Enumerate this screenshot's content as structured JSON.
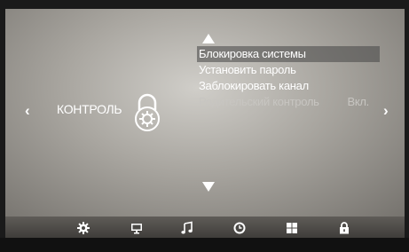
{
  "section": {
    "title": "КОНТРОЛЬ",
    "icon": "lock-gear-icon"
  },
  "nav": {
    "left_icon": "chevron-left-icon",
    "right_icon": "chevron-right-icon",
    "left_glyph": "‹",
    "right_glyph": "›"
  },
  "menu": {
    "items": [
      {
        "label": "Блокировка системы",
        "selected": true
      },
      {
        "label": "Установить пароль"
      },
      {
        "label": "Заблокировать канал"
      },
      {
        "label": "Родительский контроль",
        "value": "Вкл.",
        "disabled": true
      }
    ]
  },
  "bottom_bar": {
    "icons": [
      "gear-icon",
      "monitor-icon",
      "music-note-icon",
      "clock-icon",
      "windows-icon",
      "lock-icon"
    ],
    "active": "lock-icon"
  },
  "colors": {
    "text": "#ffffff",
    "disabled_text": "#c7c5c1",
    "highlight": "#555555"
  }
}
